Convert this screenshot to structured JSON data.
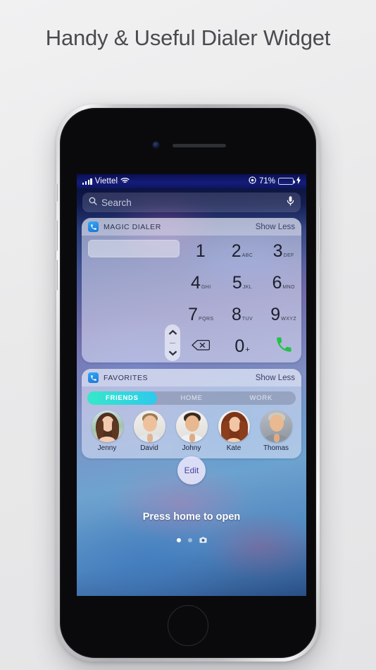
{
  "headline": "Handy & Useful Dialer Widget",
  "status_bar": {
    "carrier": "Viettel",
    "wifi_icon": "wifi-icon",
    "signal_icon": "signal-bars-icon",
    "location_icon": "location-services-icon",
    "battery_percent": "71%",
    "battery_level": 71,
    "charging_icon": "lightning-bolt-icon",
    "battery_color": "#4cd964"
  },
  "search": {
    "placeholder": "Search",
    "search_icon": "search-icon",
    "mic_icon": "microphone-icon"
  },
  "dialer_widget": {
    "app_icon": "phone-app-icon",
    "title": "MAGIC DIALER",
    "show_less_label": "Show Less",
    "number_field_value": "",
    "keys": [
      {
        "digit": "1",
        "letters": ""
      },
      {
        "digit": "2",
        "letters": "ABC"
      },
      {
        "digit": "3",
        "letters": "DEF"
      },
      {
        "digit": "4",
        "letters": "GHI"
      },
      {
        "digit": "5",
        "letters": "JKL"
      },
      {
        "digit": "6",
        "letters": "MNO"
      },
      {
        "digit": "7",
        "letters": "PQRS"
      },
      {
        "digit": "8",
        "letters": "TUV"
      },
      {
        "digit": "9",
        "letters": "WXYZ"
      },
      {
        "digit": "0",
        "letters": "+"
      }
    ],
    "backspace_icon": "backspace-icon",
    "call_icon": "phone-handset-icon",
    "call_color": "#22c248",
    "stepper_up_icon": "chevron-up-icon",
    "stepper_down_icon": "chevron-down-icon"
  },
  "favorites_widget": {
    "app_icon": "phone-app-icon",
    "title": "FAVORITES",
    "show_less_label": "Show Less",
    "tabs": [
      {
        "label": "FRIENDS",
        "active": true
      },
      {
        "label": "HOME",
        "active": false
      },
      {
        "label": "WORK",
        "active": false
      }
    ],
    "active_tab_color": "#2ec9ec",
    "contacts": [
      {
        "name": "Jenny"
      },
      {
        "name": "David"
      },
      {
        "name": "Johny"
      },
      {
        "name": "Kate"
      },
      {
        "name": "Thomas"
      }
    ]
  },
  "home_screen": {
    "edit_label": "Edit",
    "press_home_label": "Press home to open",
    "page_dots": [
      {
        "active": true
      },
      {
        "active": false
      }
    ],
    "camera_icon": "camera-icon"
  }
}
